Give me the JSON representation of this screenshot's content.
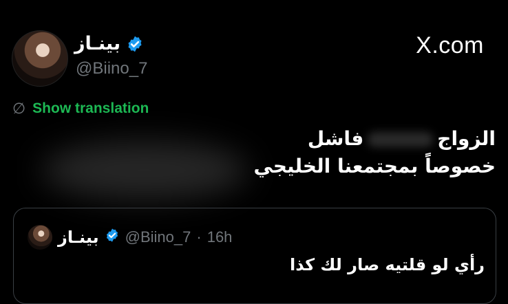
{
  "author": {
    "display_name": "بينـاز",
    "handle": "@Biino_7"
  },
  "brand": "X.com",
  "translation": {
    "icon": "globe-slash-icon",
    "label": "Show translation"
  },
  "tweet": {
    "line1_start": "الزواج",
    "line1_end": "فاشل",
    "line2": "خصوصاً بمجتمعنا الخليجي"
  },
  "quote": {
    "display_name": "بينـاز",
    "handle": "@Biino_7",
    "separator": "·",
    "time": "16h",
    "text": "رأي لو قلتيه صار لك كذا"
  },
  "colors": {
    "background": "#000000",
    "verified": "#1d9bf0",
    "translation": "#1db954",
    "secondary_text": "#71767b"
  }
}
